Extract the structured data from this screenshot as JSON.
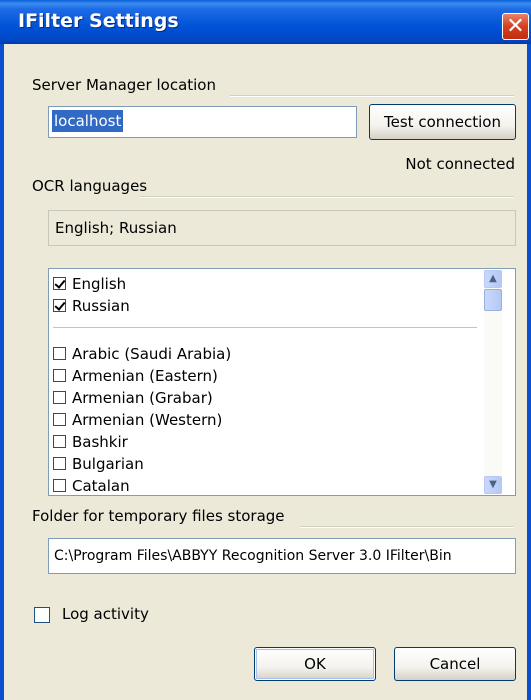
{
  "window": {
    "title": "IFilter Settings"
  },
  "server": {
    "group_label": "Server Manager location",
    "host_value": "localhost",
    "test_button_label": "Test connection",
    "status": "Not connected"
  },
  "ocr": {
    "group_label": "OCR languages",
    "selected_summary": "English; Russian",
    "checked_items": [
      {
        "label": "English",
        "checked": true
      },
      {
        "label": "Russian",
        "checked": true
      }
    ],
    "items": [
      {
        "label": "Arabic (Saudi Arabia)",
        "checked": false
      },
      {
        "label": "Armenian (Eastern)",
        "checked": false
      },
      {
        "label": "Armenian (Grabar)",
        "checked": false
      },
      {
        "label": "Armenian (Western)",
        "checked": false
      },
      {
        "label": "Bashkir",
        "checked": false
      },
      {
        "label": "Bulgarian",
        "checked": false
      },
      {
        "label": "Catalan",
        "checked": false
      }
    ]
  },
  "temp_folder": {
    "group_label": "Folder for temporary files storage",
    "path": "C:\\Program Files\\ABBYY Recognition Server 3.0 IFilter\\Bin"
  },
  "log": {
    "label": "Log activity",
    "checked": false
  },
  "buttons": {
    "ok": "OK",
    "cancel": "Cancel"
  },
  "icons": {
    "close": "close-icon",
    "scroll_up": "arrow-up-icon",
    "scroll_down": "arrow-down-icon"
  }
}
